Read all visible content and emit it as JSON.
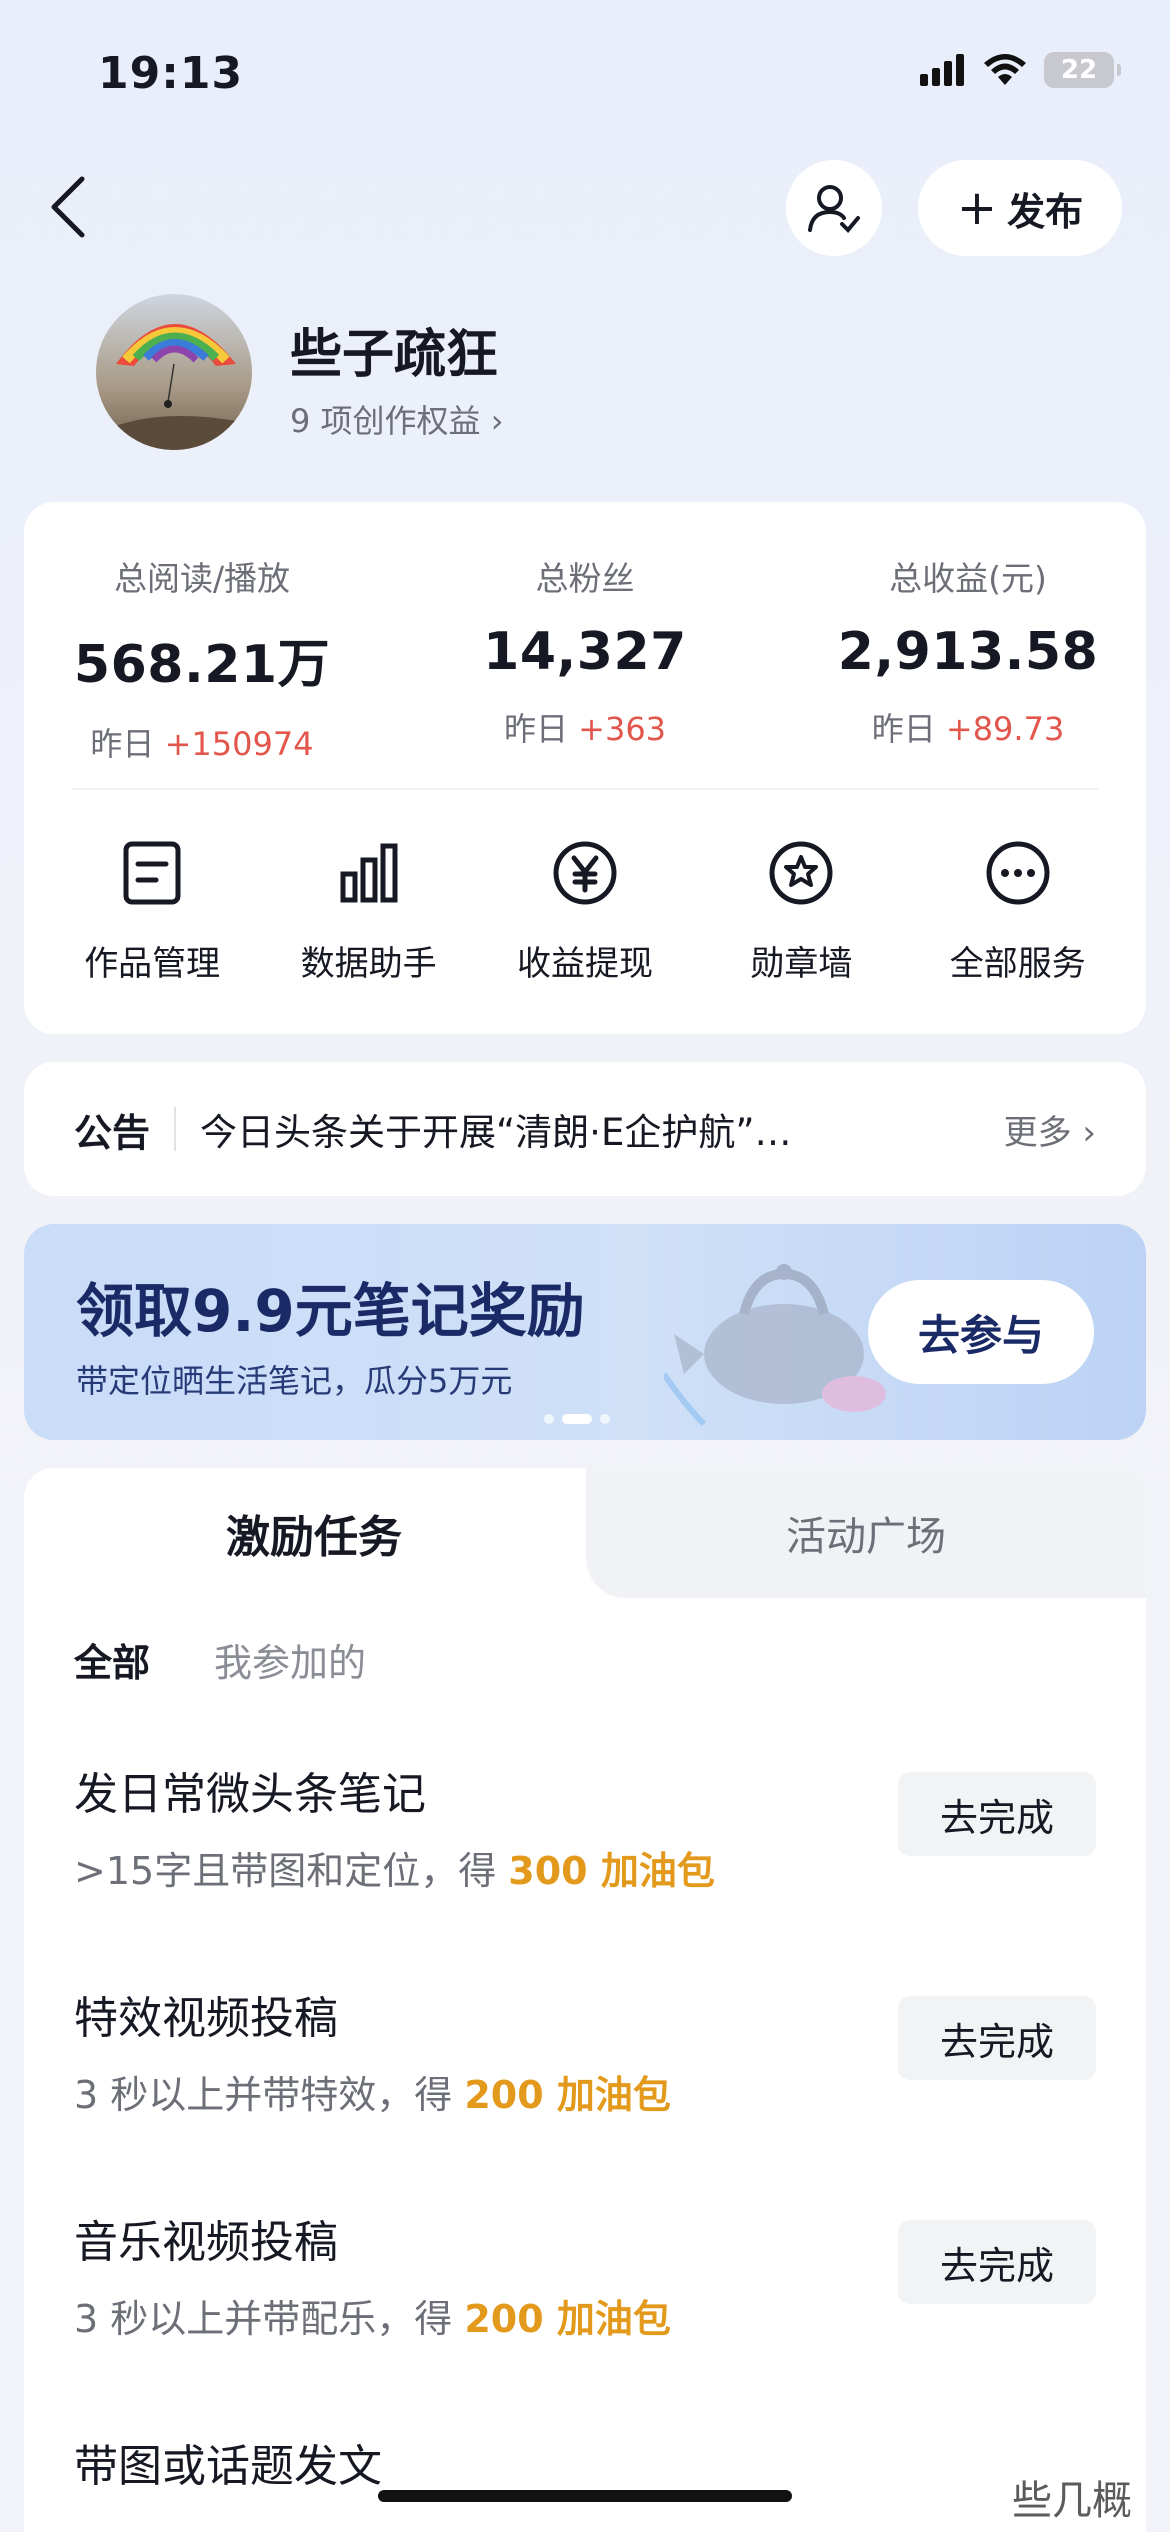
{
  "status_bar": {
    "time": "19:13",
    "battery": "22"
  },
  "header": {
    "publish_label": "发布"
  },
  "profile": {
    "name": "些子疏狂",
    "benefits": "9 项创作权益 ›"
  },
  "stats": [
    {
      "label": "总阅读/播放",
      "value": "568.21万",
      "delta_prefix": "昨日 ",
      "delta": "+150974"
    },
    {
      "label": "总粉丝",
      "value": "14,327",
      "delta_prefix": "昨日 ",
      "delta": "+363"
    },
    {
      "label": "总收益(元)",
      "value": "2,913.58",
      "delta_prefix": "昨日 ",
      "delta": "+89.73"
    }
  ],
  "services": [
    {
      "label": "作品管理",
      "icon": "document-icon"
    },
    {
      "label": "数据助手",
      "icon": "bar-chart-icon"
    },
    {
      "label": "收益提现",
      "icon": "yen-icon"
    },
    {
      "label": "勋章墙",
      "icon": "badge-icon"
    },
    {
      "label": "全部服务",
      "icon": "more-icon"
    }
  ],
  "notice": {
    "tag": "公告",
    "text": "今日头条关于开展“清朗·E企护航”…",
    "more": "更多 ›"
  },
  "banner": {
    "title": "领取9.9元笔记奖励",
    "subtitle": "带定位晒生活笔记，瓜分5万元",
    "button": "去参与"
  },
  "tasks": {
    "tabs": [
      "激励任务",
      "活动广场"
    ],
    "filters": [
      "全部",
      "我参加的"
    ],
    "items": [
      {
        "title": "发日常微头条笔记",
        "desc_prefix": ">15字且带图和定位，得 ",
        "reward": "300 加油包",
        "button": "去完成"
      },
      {
        "title": "特效视频投稿",
        "desc_prefix": "3 秒以上并带特效，得 ",
        "reward": "200 加油包",
        "button": "去完成"
      },
      {
        "title": "音乐视频投稿",
        "desc_prefix": "3 秒以上并带配乐，得 ",
        "reward": "200 加油包",
        "button": "去完成"
      },
      {
        "title": "带图或话题发文",
        "desc_prefix": "",
        "reward": "",
        "button": ""
      }
    ]
  },
  "watermark": "些几概"
}
